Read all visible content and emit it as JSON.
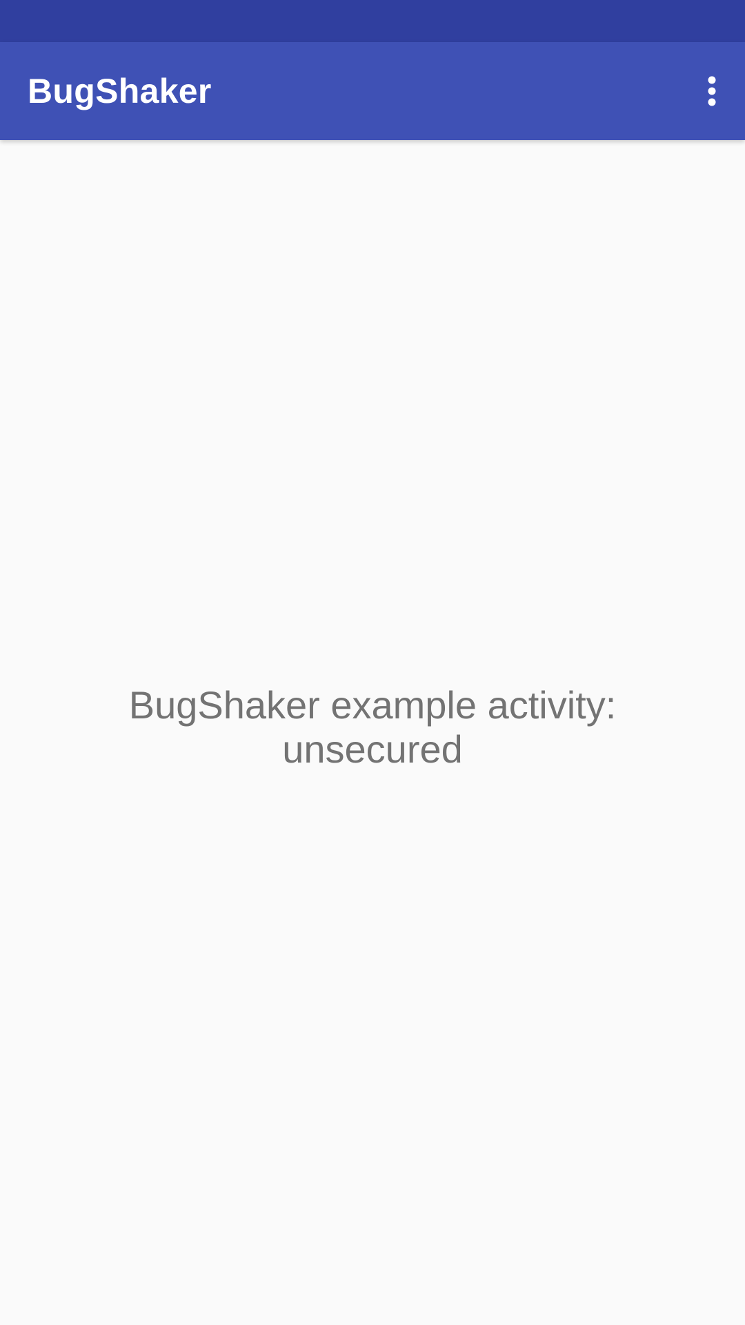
{
  "status_bar": {
    "color": "#303f9f"
  },
  "app_bar": {
    "title": "BugShaker",
    "color": "#3f51b5",
    "overflow_icon": "more-vert-icon"
  },
  "content": {
    "message": "BugShaker example activity:\nunsecured",
    "background": "#fafafa"
  }
}
